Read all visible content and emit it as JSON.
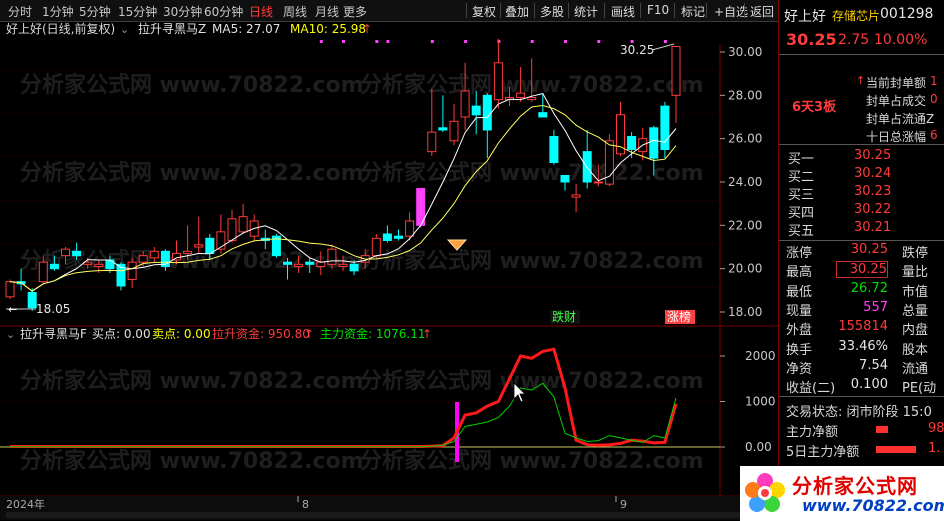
{
  "periods": [
    "分时",
    "1分钟",
    "5分钟",
    "15分钟",
    "30分钟",
    "60分钟",
    "日线",
    "周线",
    "月线",
    "更多"
  ],
  "active_period": "日线",
  "toolbar": [
    "复权",
    "叠加",
    "多股",
    "统计",
    "画线",
    "F10",
    "标记",
    "+自选",
    "返回"
  ],
  "main_header": {
    "title": "好上好(日线,前复权)",
    "indicator": "拉升寻黑马Z",
    "ma5": "MA5: 27.07",
    "ma10": "MA10: 25.98"
  },
  "sub_header": {
    "indicator": "拉升寻黑马F",
    "buy": "买点: 0.00",
    "sell": "卖点: 0.00",
    "pull": "拉升资金: 950.80",
    "main": "主力资金: 1076.11"
  },
  "price_axis": [
    "30.00",
    "28.00",
    "26.00",
    "24.00",
    "22.00",
    "20.00",
    "18.00"
  ],
  "sub_axis": [
    "2000",
    "1000",
    "0.00"
  ],
  "annotations": {
    "high": "30.25",
    "low": "18.05",
    "tag_diecai": "跌财",
    "tag_zhangbang": "涨榜"
  },
  "date_axis": [
    "2024年",
    "8",
    "9"
  ],
  "watermark": "分析家公式网 www.70822.com",
  "logo": {
    "text": "分析家公式网",
    "url": "www.70822.com"
  },
  "stock": {
    "name": "好上好",
    "tag": "存储芯片",
    "code": "001298",
    "price": "30.25",
    "change": "2.75",
    "pct": "10.00%",
    "streak": "6天3板"
  },
  "seal_info": [
    {
      "label": "当前封单额",
      "value": "1"
    },
    {
      "label": "封单占成交",
      "value": "0"
    },
    {
      "label": "封单占流通Z",
      "value": ""
    },
    {
      "label": "十日总涨幅",
      "value": "6"
    }
  ],
  "orderbook": [
    {
      "label": "买一",
      "price": "30.25"
    },
    {
      "label": "买二",
      "price": "30.24"
    },
    {
      "label": "买三",
      "price": "30.23"
    },
    {
      "label": "买四",
      "price": "30.22"
    },
    {
      "label": "买五",
      "price": "30.21"
    }
  ],
  "quote": [
    {
      "l": "涨停",
      "v": "30.25",
      "l2": "跌停"
    },
    {
      "l": "最高",
      "v": "30.25",
      "l2": "量比"
    },
    {
      "l": "最低",
      "v": "26.72",
      "l2": "市值"
    },
    {
      "l": "现量",
      "v": "557",
      "l2": "总量"
    },
    {
      "l": "外盘",
      "v": "155814",
      "l2": "内盘"
    },
    {
      "l": "换手",
      "v": "33.46%",
      "l2": "股本"
    },
    {
      "l": "净资",
      "v": "7.54",
      "l2": "流通"
    },
    {
      "l": "收益(二)",
      "v": "0.100",
      "l2": "PE(动"
    }
  ],
  "trade_status": "交易状态: 闭市阶段 15:0",
  "flows": [
    {
      "label": "主力净额",
      "value": "98"
    },
    {
      "label": "5日主力净额",
      "value": "1."
    }
  ],
  "chart_data": {
    "type": "candlestick",
    "y_axis": [
      18,
      30
    ],
    "candles": [
      [
        18.7,
        19.4,
        19.5,
        18.6
      ],
      [
        19.4,
        19.3,
        20.0,
        19.0
      ],
      [
        18.9,
        18.2,
        19.1,
        18.05
      ],
      [
        19.4,
        20.3,
        20.6,
        19.3
      ],
      [
        20.2,
        20.0,
        20.6,
        19.9
      ],
      [
        20.6,
        20.9,
        21.0,
        20.2
      ],
      [
        20.8,
        20.6,
        21.2,
        20.4
      ],
      [
        20.2,
        20.3,
        20.5,
        20.0
      ],
      [
        20.1,
        20.2,
        20.4,
        19.8
      ],
      [
        20.4,
        20.0,
        20.6,
        19.8
      ],
      [
        20.2,
        19.2,
        20.3,
        19.0
      ],
      [
        19.5,
        20.3,
        20.5,
        19.1
      ],
      [
        20.3,
        20.6,
        20.8,
        20.1
      ],
      [
        20.5,
        20.8,
        21.0,
        20.3
      ],
      [
        20.8,
        20.1,
        20.9,
        19.9
      ],
      [
        20.4,
        20.7,
        21.3,
        20.2
      ],
      [
        20.7,
        20.8,
        22.0,
        20.4
      ],
      [
        21.0,
        21.1,
        22.4,
        20.7
      ],
      [
        21.4,
        20.7,
        21.6,
        20.4
      ],
      [
        20.9,
        21.7,
        22.5,
        20.7
      ],
      [
        21.3,
        22.3,
        22.7,
        21.2
      ],
      [
        21.7,
        22.4,
        23.0,
        21.6
      ],
      [
        21.5,
        22.2,
        22.5,
        21.3
      ],
      [
        21.4,
        21.3,
        21.8,
        20.9
      ],
      [
        21.5,
        20.6,
        21.6,
        20.5
      ],
      [
        20.3,
        20.2,
        20.5,
        19.5
      ],
      [
        20.1,
        20.2,
        20.6,
        19.8
      ],
      [
        20.3,
        20.2,
        20.5,
        19.8
      ],
      [
        20.1,
        20.3,
        20.8,
        19.7
      ],
      [
        20.2,
        20.9,
        21.1,
        20.0
      ],
      [
        20.1,
        20.2,
        20.6,
        19.9
      ],
      [
        20.2,
        19.9,
        20.4,
        19.7
      ],
      [
        20.3,
        20.6,
        20.9,
        20.0
      ],
      [
        20.6,
        21.4,
        21.6,
        20.5
      ],
      [
        21.6,
        21.3,
        22.0,
        21.2
      ],
      [
        21.5,
        21.4,
        21.8,
        21.3
      ],
      [
        21.5,
        22.2,
        22.6,
        21.3
      ],
      [
        22.0,
        23.7,
        23.7,
        21.9
      ],
      [
        25.4,
        26.3,
        28.3,
        25.2
      ],
      [
        26.5,
        26.4,
        28.0,
        26.3
      ],
      [
        25.9,
        26.8,
        27.6,
        25.7
      ],
      [
        27.0,
        28.2,
        29.5,
        26.4
      ],
      [
        27.5,
        27.1,
        28.2,
        26.2
      ],
      [
        28.0,
        26.4,
        28.1,
        25.1
      ],
      [
        27.8,
        29.5,
        30.6,
        27.4
      ],
      [
        27.8,
        27.9,
        28.4,
        27.5
      ],
      [
        27.9,
        28.1,
        29.3,
        27.7
      ],
      [
        27.8,
        27.9,
        29.7,
        27.7
      ],
      [
        27.2,
        27.0,
        28.1,
        27.2
      ],
      [
        26.1,
        24.9,
        26.4,
        24.8
      ],
      [
        24.3,
        24.0,
        24.3,
        23.6
      ],
      [
        23.3,
        23.4,
        23.9,
        22.6
      ],
      [
        25.4,
        24.0,
        26.4,
        23.7
      ],
      [
        24.0,
        24.0,
        24.8,
        23.8
      ],
      [
        23.9,
        25.9,
        26.2,
        23.8
      ],
      [
        25.3,
        27.1,
        27.7,
        25.2
      ],
      [
        26.1,
        25.5,
        26.3,
        25.1
      ],
      [
        25.4,
        26.0,
        26.5,
        25.0
      ],
      [
        26.5,
        25.1,
        26.6,
        24.3
      ],
      [
        27.5,
        25.5,
        27.7,
        25.1
      ],
      [
        28.0,
        30.25,
        30.25,
        26.72
      ]
    ],
    "flow_series": [
      {
        "name": "拉升资金",
        "values": [
          10,
          10,
          10,
          10,
          10,
          10,
          10,
          10,
          10,
          10,
          10,
          10,
          10,
          10,
          10,
          10,
          10,
          10,
          10,
          10,
          10,
          10,
          10,
          10,
          10,
          10,
          10,
          10,
          10,
          10,
          10,
          10,
          10,
          10,
          10,
          10,
          10,
          10,
          20,
          30,
          200,
          700,
          750,
          900,
          1000,
          1500,
          2000,
          1950,
          2100,
          2150,
          1300,
          150,
          50,
          40,
          50,
          80,
          150,
          130,
          90,
          100,
          950
        ]
      },
      {
        "name": "主力资金",
        "values": [
          5,
          5,
          5,
          5,
          5,
          5,
          5,
          5,
          5,
          5,
          5,
          5,
          5,
          5,
          5,
          5,
          5,
          5,
          5,
          5,
          5,
          5,
          5,
          5,
          5,
          5,
          5,
          5,
          5,
          5,
          5,
          5,
          5,
          5,
          5,
          5,
          5,
          5,
          15,
          40,
          120,
          450,
          500,
          550,
          650,
          900,
          1300,
          1250,
          1400,
          1100,
          300,
          200,
          120,
          140,
          250,
          200,
          150,
          100,
          250,
          200,
          1076
        ]
      }
    ]
  }
}
